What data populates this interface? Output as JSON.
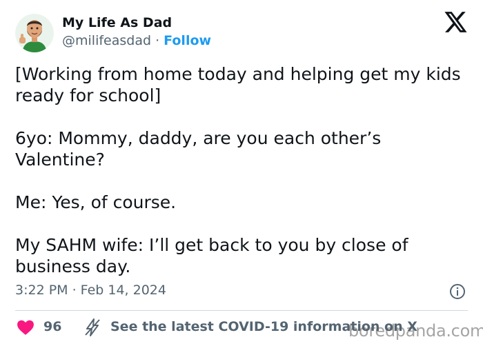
{
  "author": {
    "display_name": "My Life As Dad",
    "handle": "@milifeasdad",
    "separator": "·",
    "follow_label": "Follow"
  },
  "tweet": {
    "paragraphs": [
      "[Working from home today and helping get my kids ready for school]",
      "6yo:  Mommy, daddy, are you each other’s Valentine?",
      "Me: Yes, of course.",
      "My SAHM wife: I’ll get back to you by close of business day."
    ],
    "timestamp": "3:22 PM · Feb 14, 2024"
  },
  "footer": {
    "like_count": "96",
    "covid_text": "See the latest COVID-19 information on X"
  },
  "watermark": "boredpanda.com",
  "icons": {
    "logo": "x-logo-icon",
    "info": "info-icon",
    "like": "heart-icon",
    "covid": "lightning-bolt-icon"
  },
  "colors": {
    "text": "#0f1419",
    "secondary": "#536471",
    "accent": "#1d9bf0",
    "heart": "#f91880",
    "divider": "#cfd9de"
  }
}
